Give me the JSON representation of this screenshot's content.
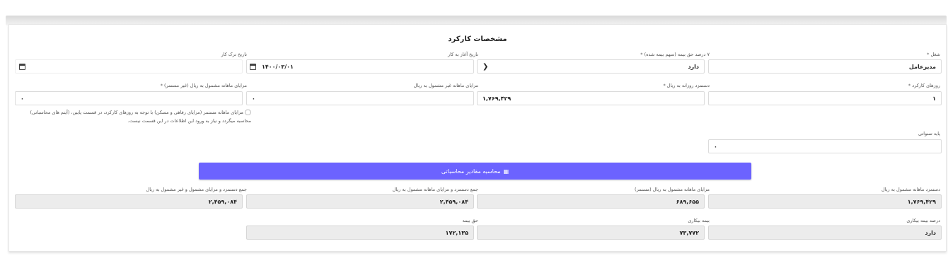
{
  "card": {
    "title": "مشخصات کارکرد"
  },
  "fields": {
    "job": {
      "label": "شغل *",
      "value": "مدیرعامل"
    },
    "insurance_share": {
      "label": "۷ درصد حق بیمه (سهم بیمه شده) *",
      "value": "دارد"
    },
    "start_date": {
      "label": "تاریخ آغاز به کار",
      "value": "۱۴۰۰/۰۳/۰۱"
    },
    "end_date": {
      "label": "تاریخ ترک کار",
      "value": ""
    },
    "work_days": {
      "label": "روزهای کارکرد *",
      "value": "۱"
    },
    "daily_wage": {
      "label": "دستمزد روزانه به ریال *",
      "value": "۱,۷۶۹,۴۲۹"
    },
    "non_insured_benefits": {
      "label": "مزایای ماهانه غیر مشمول به ریال",
      "value": "۰"
    },
    "insured_benefits_nonfixed": {
      "label": "مزایای ماهانه مشمول به ریال (غیر مستمر) *",
      "value": "۰"
    },
    "seniority_base": {
      "label": "پایه سنواتی",
      "value": "۰"
    }
  },
  "hint": {
    "text": "مزایای ماهانه مستمر (مزایای رفاهی و مسکن) با توجه به روزهای کارکرد، در قسمت پایین، (آیتم های محاسباتی) محاسبه میگردد و نیاز به ورود این اطلاعات در این قسمت نیست."
  },
  "calc_button": {
    "label": "محاسبه مقادیر محاسباتی"
  },
  "results": {
    "monthly_insured_wage": {
      "label": "دستمزد ماهانه مشمول به ریال",
      "value": "۱,۷۶۹,۴۲۹"
    },
    "insured_fixed_benefits": {
      "label": "مزایای ماهانه مشمول به ریال (مستمر)",
      "value": "۶۸۹,۶۵۵"
    },
    "total_insured": {
      "label": "جمع دستمزد و مزایای ماهانه مشمول به ریال",
      "value": "۲,۴۵۹,۰۸۴"
    },
    "total_all": {
      "label": "جمع دستمزد و مزایای مشمول و غیر مشمول به ریال",
      "value": "۲,۴۵۹,۰۸۴"
    },
    "unemployment_rate": {
      "label": "درصد بیمه بیکاری",
      "value": "دارد"
    },
    "unemployment_insurance": {
      "label": "بیمه بیکاری",
      "value": "۷۳,۷۷۲"
    },
    "insurance_premium": {
      "label": "حق بیمه",
      "value": "۱۷۲,۱۳۵"
    }
  },
  "icons": {
    "date_picker": "calendar-icon",
    "dropdown": "chevron-down-icon",
    "hint": "lightbulb-icon",
    "calc": "calculator-icon"
  },
  "colors": {
    "accent": "#6c63ff",
    "readonly_bg": "#ececec"
  }
}
